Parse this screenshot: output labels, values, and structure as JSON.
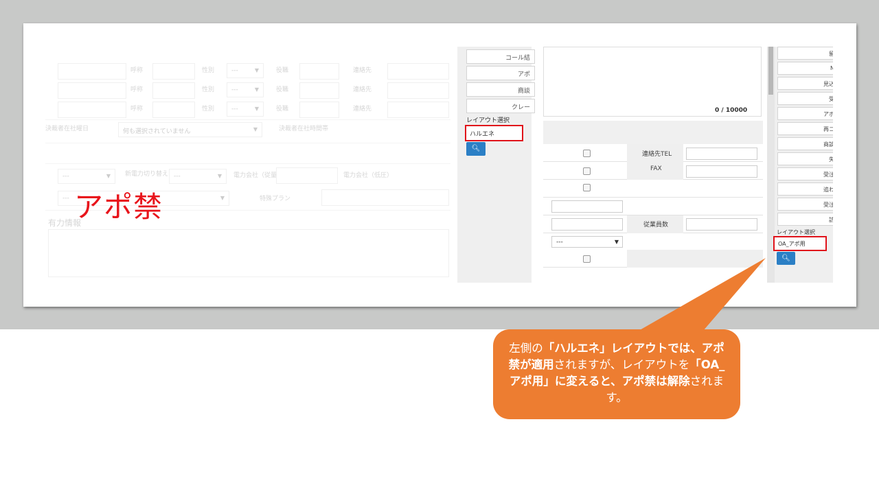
{
  "left_ghost": {
    "row_labels": [
      "呼称",
      "性別",
      "役職",
      "連絡先"
    ],
    "select_placeholder": "---",
    "field_decision_date": "決裁者在社曜日",
    "field_decision_select": "何も選択されていません",
    "field_decision_time": "決裁者在社時間帯",
    "field_power_switch": "新電力切り替え",
    "field_power_company_old": "電力会社（従量）",
    "field_power_company_new": "電力会社（低圧）",
    "field_plan": "特殊プラン",
    "field_info": "有力情報",
    "stamp": "アポ禁"
  },
  "left_panel": {
    "buttons": [
      "コール結",
      "アポ",
      "商談",
      "クレー"
    ],
    "layout_label": "レイアウト選択",
    "layout_value": "ハルエネ",
    "search_icon": "search-icon"
  },
  "middle_panel": {
    "counter": "0 / 10000",
    "label_tel": "連絡先TEL",
    "label_fax": "FAX",
    "label_employees": "従業員数",
    "select_value": "---"
  },
  "right_panel": {
    "buttons": [
      "留",
      "N",
      "見込",
      "受",
      "アポ",
      "再コ",
      "商談",
      "失",
      "受注",
      "追わ",
      "受注",
      "訪"
    ],
    "layout_label": "レイアウト選択",
    "layout_value": "OA_アポ用",
    "search_icon": "search-icon"
  },
  "callout": {
    "p1": "左側の",
    "p2": "「ハルエネ」レイアウトでは、アポ禁が適用",
    "p3": "されますが、レイアウトを",
    "p4": "「OA_アポ用」に変えると、アポ禁は解除",
    "p5": "されます。",
    "fill": "#ed7d31"
  },
  "colors": {
    "highlight_red": "#e0121a",
    "button_blue": "#2b7fc5"
  }
}
